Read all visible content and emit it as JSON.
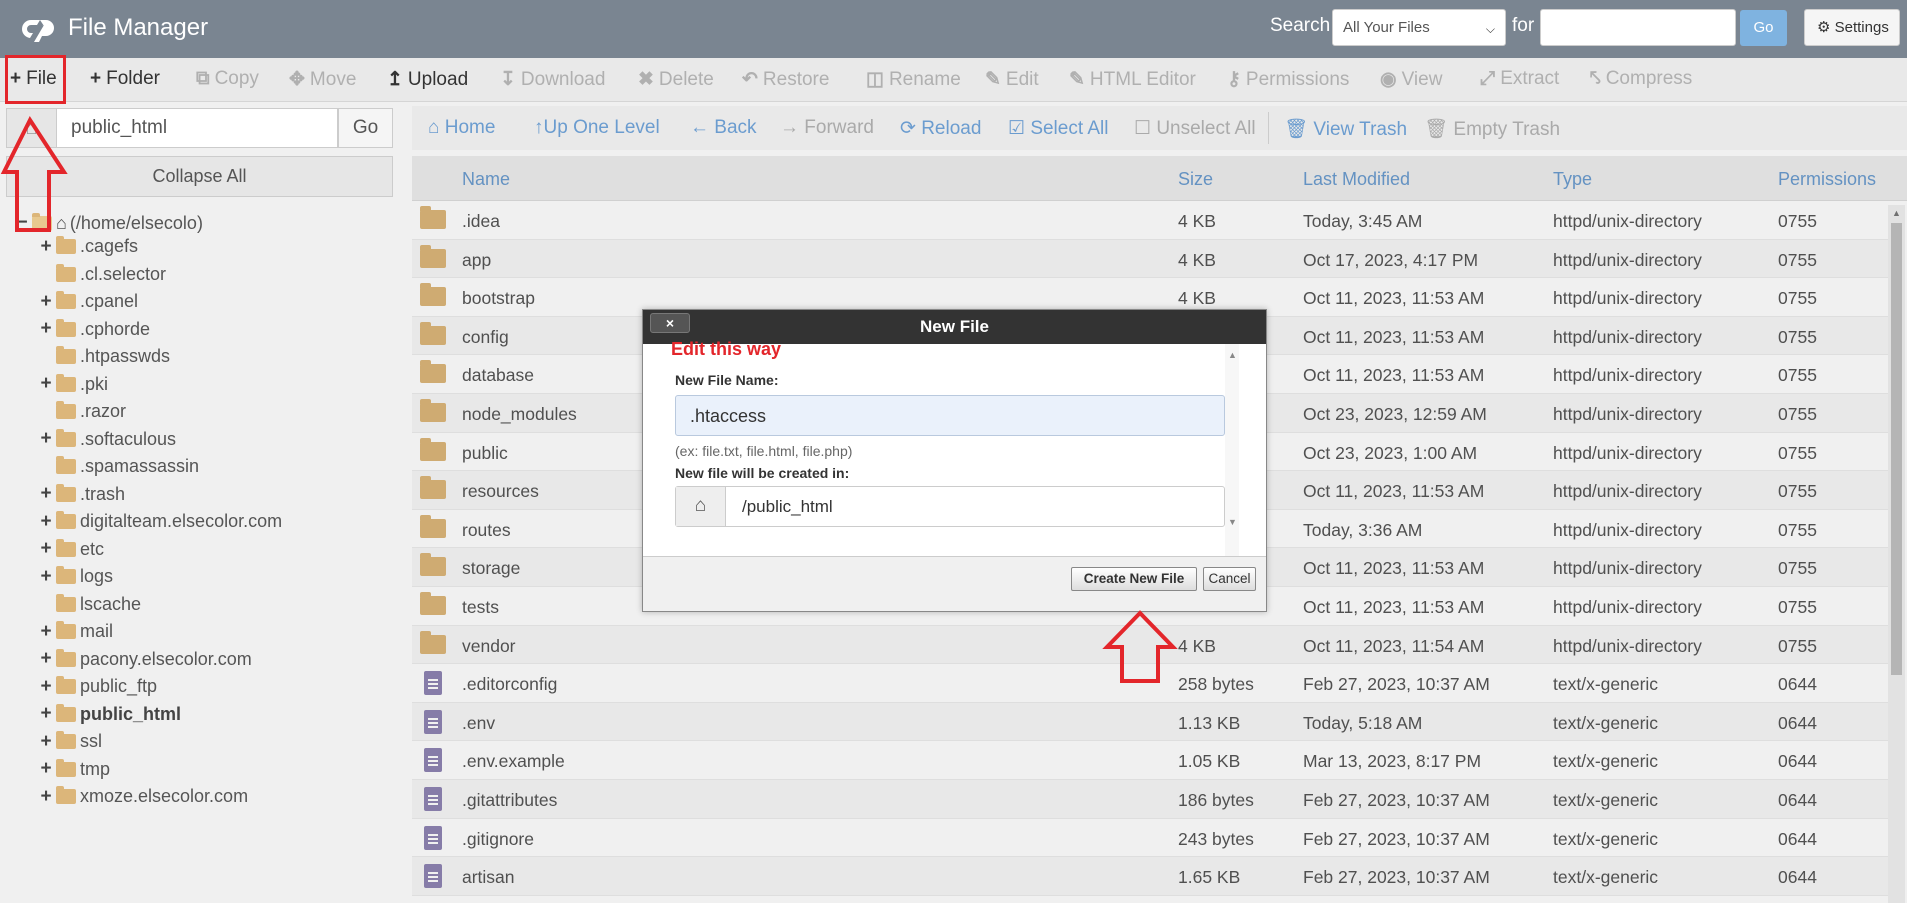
{
  "header": {
    "title": "File Manager",
    "search_label": "Search",
    "search_scope": "All Your Files",
    "for_label": "for",
    "search_value": "",
    "go_label": "Go",
    "settings_label": "Settings"
  },
  "toolbar": {
    "file": "File",
    "folder": "Folder",
    "copy": "Copy",
    "move": "Move",
    "upload": "Upload",
    "download": "Download",
    "delete": "Delete",
    "restore": "Restore",
    "rename": "Rename",
    "edit": "Edit",
    "html_editor": "HTML Editor",
    "permissions": "Permissions",
    "view": "View",
    "extract": "Extract",
    "compress": "Compress"
  },
  "sidebar": {
    "path_value": "public_html",
    "go_label": "Go",
    "collapse_label": "Collapse All",
    "root_label": "(/home/elsecolo)",
    "tree": [
      {
        "label": ".cagefs",
        "expandable": true
      },
      {
        "label": ".cl.selector",
        "expandable": false
      },
      {
        "label": ".cpanel",
        "expandable": true
      },
      {
        "label": ".cphorde",
        "expandable": true
      },
      {
        "label": ".htpasswds",
        "expandable": false
      },
      {
        "label": ".pki",
        "expandable": true
      },
      {
        "label": ".razor",
        "expandable": false
      },
      {
        "label": ".softaculous",
        "expandable": true
      },
      {
        "label": ".spamassassin",
        "expandable": false
      },
      {
        "label": ".trash",
        "expandable": true
      },
      {
        "label": "digitalteam.elsecolor.com",
        "expandable": true
      },
      {
        "label": "etc",
        "expandable": true
      },
      {
        "label": "logs",
        "expandable": true
      },
      {
        "label": "lscache",
        "expandable": false
      },
      {
        "label": "mail",
        "expandable": true
      },
      {
        "label": "pacony.elsecolor.com",
        "expandable": true
      },
      {
        "label": "public_ftp",
        "expandable": true
      },
      {
        "label": "public_html",
        "expandable": true,
        "current": true
      },
      {
        "label": "ssl",
        "expandable": true
      },
      {
        "label": "tmp",
        "expandable": true
      },
      {
        "label": "xmoze.elsecolor.com",
        "expandable": true
      }
    ]
  },
  "nav": {
    "home": "Home",
    "up": "Up One Level",
    "back": "Back",
    "forward": "Forward",
    "reload": "Reload",
    "select_all": "Select All",
    "unselect_all": "Unselect All",
    "view_trash": "View Trash",
    "empty_trash": "Empty Trash"
  },
  "table": {
    "columns": {
      "name": "Name",
      "size": "Size",
      "modified": "Last Modified",
      "type": "Type",
      "permissions": "Permissions"
    },
    "rows": [
      {
        "name": ".idea",
        "size": "4 KB",
        "modified": "Today, 3:45 AM",
        "type": "httpd/unix-directory",
        "perm": "0755",
        "kind": "folder"
      },
      {
        "name": "app",
        "size": "4 KB",
        "modified": "Oct 17, 2023, 4:17 PM",
        "type": "httpd/unix-directory",
        "perm": "0755",
        "kind": "folder"
      },
      {
        "name": "bootstrap",
        "size": "4 KB",
        "modified": "Oct 11, 2023, 11:53 AM",
        "type": "httpd/unix-directory",
        "perm": "0755",
        "kind": "folder"
      },
      {
        "name": "config",
        "size": "",
        "modified": "Oct 11, 2023, 11:53 AM",
        "type": "httpd/unix-directory",
        "perm": "0755",
        "kind": "folder"
      },
      {
        "name": "database",
        "size": "",
        "modified": "Oct 11, 2023, 11:53 AM",
        "type": "httpd/unix-directory",
        "perm": "0755",
        "kind": "folder"
      },
      {
        "name": "node_modules",
        "size": "",
        "modified": "Oct 23, 2023, 12:59 AM",
        "type": "httpd/unix-directory",
        "perm": "0755",
        "kind": "folder"
      },
      {
        "name": "public",
        "size": "",
        "modified": "Oct 23, 2023, 1:00 AM",
        "type": "httpd/unix-directory",
        "perm": "0755",
        "kind": "folder"
      },
      {
        "name": "resources",
        "size": "",
        "modified": "Oct 11, 2023, 11:53 AM",
        "type": "httpd/unix-directory",
        "perm": "0755",
        "kind": "folder"
      },
      {
        "name": "routes",
        "size": "",
        "modified": "Today, 3:36 AM",
        "type": "httpd/unix-directory",
        "perm": "0755",
        "kind": "folder"
      },
      {
        "name": "storage",
        "size": "",
        "modified": "Oct 11, 2023, 11:53 AM",
        "type": "httpd/unix-directory",
        "perm": "0755",
        "kind": "folder"
      },
      {
        "name": "tests",
        "size": "",
        "modified": "Oct 11, 2023, 11:53 AM",
        "type": "httpd/unix-directory",
        "perm": "0755",
        "kind": "folder"
      },
      {
        "name": "vendor",
        "size": "4 KB",
        "modified": "Oct 11, 2023, 11:54 AM",
        "type": "httpd/unix-directory",
        "perm": "0755",
        "kind": "folder"
      },
      {
        "name": ".editorconfig",
        "size": "258 bytes",
        "modified": "Feb 27, 2023, 10:37 AM",
        "type": "text/x-generic",
        "perm": "0644",
        "kind": "file"
      },
      {
        "name": ".env",
        "size": "1.13 KB",
        "modified": "Today, 5:18 AM",
        "type": "text/x-generic",
        "perm": "0644",
        "kind": "file"
      },
      {
        "name": ".env.example",
        "size": "1.05 KB",
        "modified": "Mar 13, 2023, 8:17 PM",
        "type": "text/x-generic",
        "perm": "0644",
        "kind": "file"
      },
      {
        "name": ".gitattributes",
        "size": "186 bytes",
        "modified": "Feb 27, 2023, 10:37 AM",
        "type": "text/x-generic",
        "perm": "0644",
        "kind": "file"
      },
      {
        "name": ".gitignore",
        "size": "243 bytes",
        "modified": "Feb 27, 2023, 10:37 AM",
        "type": "text/x-generic",
        "perm": "0644",
        "kind": "file"
      },
      {
        "name": "artisan",
        "size": "1.65 KB",
        "modified": "Feb 27, 2023, 10:37 AM",
        "type": "text/x-generic",
        "perm": "0644",
        "kind": "file"
      }
    ]
  },
  "modal": {
    "title": "New File",
    "close_label": "×",
    "annotation": "Edit this way",
    "name_label": "New File Name:",
    "name_value": ".htaccess",
    "name_hint": "(ex: file.txt, file.html, file.php)",
    "dir_label": "New file will be created in:",
    "dir_value": "/public_html",
    "create_label": "Create New File",
    "cancel_label": "Cancel"
  },
  "colors": {
    "header_bg": "#7a8591",
    "link_blue": "#6b9ccf",
    "folder": "#dcb67a",
    "file": "#8f84b3",
    "annotation_red": "#e3262b"
  }
}
